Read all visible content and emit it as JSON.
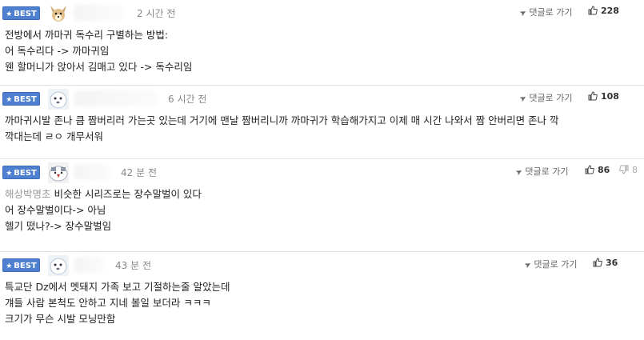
{
  "comments": [
    {
      "best_label": "BEST",
      "time": "2 시간 전",
      "reply_label": "댓글로 가기",
      "likes": "228",
      "lines": [
        "전방에서 까마귀 독수리 구별하는 방법:",
        "어 독수리다 -> 까마귀임",
        "웬 할머니가 앉아서 김매고 있다 -> 독수리임"
      ]
    },
    {
      "best_label": "BEST",
      "time": "6 시간 전",
      "reply_label": "댓글로 가기",
      "likes": "108",
      "lines": [
        "까마귀시발 존나 큼 짬버리러 가는곳 있는데 거기에 맨날 짬버리니까 까마귀가 학습해가지고 이제 매 시간 나와서 짬 안버리면 존나 깍",
        "깍대는데 ㄹㅇ 개무서워"
      ]
    },
    {
      "best_label": "BEST",
      "time": "42 분 전",
      "reply_label": "댓글로 가기",
      "likes": "86",
      "dislikes": "8",
      "mention": "해상박명초",
      "lines": [
        "비슷한 시리즈로는 장수말벌이 있다",
        "어 장수말벌이다-> 아님",
        "헬기 떴나?-> 장수말벌임"
      ]
    },
    {
      "best_label": "BEST",
      "time": "43 분 전",
      "reply_label": "댓글로 가기",
      "likes": "36",
      "lines": [
        "특교단 Dz에서 멧돼지 가족 보고 기절하는줄 알았는데",
        "걔들 사람 본척도 안하고 지네 볼일 보더라 ㅋㅋㅋ",
        "크기가 무슨 시발 모닝만함"
      ]
    }
  ]
}
